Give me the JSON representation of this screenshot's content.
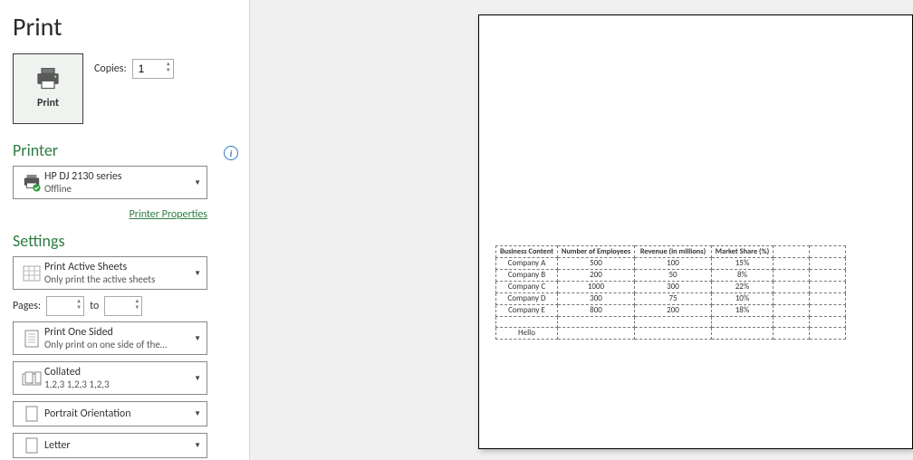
{
  "title": "Print",
  "print_button": {
    "label": "Print"
  },
  "copies": {
    "label": "Copies:",
    "value": "1"
  },
  "printer": {
    "section_title": "Printer",
    "name": "HP DJ 2130 series",
    "status": "Offline",
    "properties_link": "Printer Properties"
  },
  "settings": {
    "section_title": "Settings",
    "print_what": {
      "line1": "Print Active Sheets",
      "line2": "Only print the active sheets"
    },
    "pages": {
      "label": "Pages:",
      "to": "to",
      "from": "",
      "until": ""
    },
    "sides": {
      "line1": "Print One Sided",
      "line2": "Only print on one side of the…"
    },
    "collate": {
      "line1": "Collated",
      "line2": "1,2,3    1,2,3    1,2,3"
    },
    "orientation": {
      "line1": "Portrait Orientation"
    },
    "paper": {
      "line1": "Letter"
    }
  },
  "preview": {
    "headers": [
      "Business Content",
      "Number of Employees",
      "Revenue (in millions)",
      "Market Share (%)"
    ],
    "rows": [
      [
        "Company A",
        "500",
        "100",
        "15%"
      ],
      [
        "Company B",
        "200",
        "50",
        "8%"
      ],
      [
        "Company C",
        "1000",
        "300",
        "22%"
      ],
      [
        "Company D",
        "300",
        "75",
        "10%"
      ],
      [
        "Company E",
        "800",
        "200",
        "18%"
      ]
    ],
    "extra_rows": [
      [
        "",
        "",
        "",
        ""
      ],
      [
        "Hello",
        "",
        "",
        ""
      ]
    ]
  }
}
